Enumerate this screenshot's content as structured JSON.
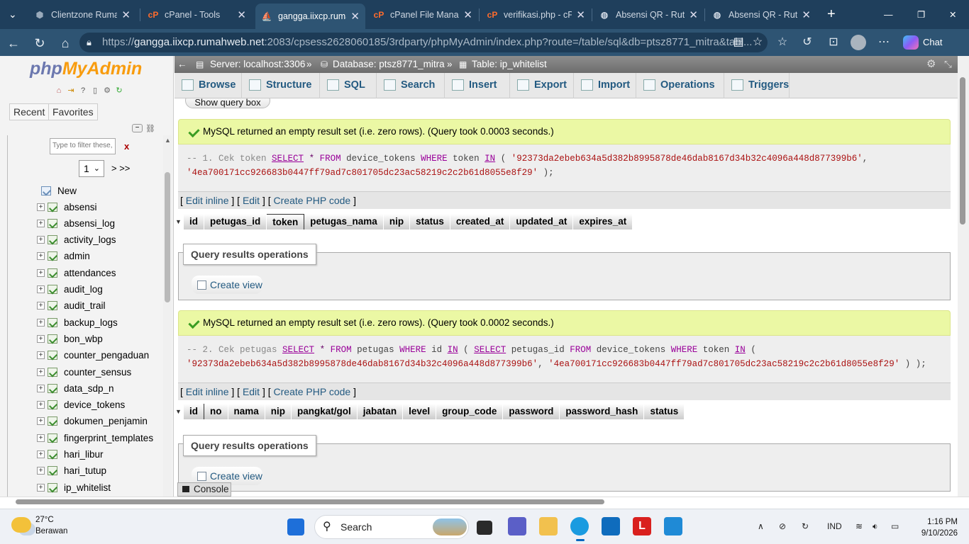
{
  "browser": {
    "tabs": [
      {
        "label": "Clientzone Rumahweb",
        "icon": "clientzone-icon"
      },
      {
        "label": "cPanel - Tools",
        "icon": "cpanel-icon"
      },
      {
        "label": "gangga.iixcp.rumahweb.net",
        "icon": "phpmyadmin-icon",
        "active": true
      },
      {
        "label": "cPanel File Manager",
        "icon": "cpanel-icon"
      },
      {
        "label": "verifikasi.php - cPanel",
        "icon": "cpanel-icon"
      },
      {
        "label": "Absensi QR - Rutan",
        "icon": "globe-icon"
      },
      {
        "label": "Absensi QR - Rutan",
        "icon": "globe-icon"
      }
    ],
    "url_prefix": "https://",
    "url_host": "gangga.iixcp.rumahweb.net",
    "url_rest": ":2083/cpsess2628060185/3rdparty/phpMyAdmin/index.php?route=/table/sql&db=ptsz8771_mitra&tabl...",
    "chat_label": "Chat"
  },
  "sidebar": {
    "logo_php": "php",
    "logo_myadmin": "MyAdmin",
    "recent_label": "Recent",
    "favorites_label": "Favorites",
    "filter_placeholder": "Type to filter these, E",
    "filter_clear": "x",
    "page_value": "1",
    "page_next": "> >>",
    "new_label": "New",
    "tables": [
      "absensi",
      "absensi_log",
      "activity_logs",
      "admin",
      "attendances",
      "audit_log",
      "audit_trail",
      "backup_logs",
      "bon_wbp",
      "counter_pengaduan",
      "counter_sensus",
      "data_sdp_n",
      "device_tokens",
      "dokumen_penjamin",
      "fingerprint_templates",
      "hari_libur",
      "hari_tutup",
      "ip_whitelist"
    ]
  },
  "breadcrumb": {
    "server": "Server: localhost:3306",
    "database": "Database: ptsz8771_mitra",
    "table": "Table: ip_whitelist",
    "sep": "»"
  },
  "menu": [
    {
      "label": "Browse",
      "icon": "browse-icon"
    },
    {
      "label": "Structure",
      "icon": "structure-icon"
    },
    {
      "label": "SQL",
      "icon": "sql-icon"
    },
    {
      "label": "Search",
      "icon": "search-icon"
    },
    {
      "label": "Insert",
      "icon": "insert-icon"
    },
    {
      "label": "Export",
      "icon": "export-icon"
    },
    {
      "label": "Import",
      "icon": "import-icon"
    },
    {
      "label": "Operations",
      "icon": "operations-icon"
    },
    {
      "label": "Triggers",
      "icon": "triggers-icon"
    }
  ],
  "content": {
    "show_query_box": "Show query box",
    "results": [
      {
        "message": "MySQL returned an empty result set (i.e. zero rows). (Query took 0.0003 seconds.)",
        "sql_line1": "-- 1. Cek token SELECT * FROM device_tokens WHERE token IN ( '92373da2ebeb634a5d382b8995878de46dab8167d34b32c4096a448d877399b6',",
        "sql_line2": "'4ea700171cc926683b0447ff79ad7c801705dc23ac58219c2c2b61d8055e8f29' );",
        "columns": [
          "id",
          "petugas_id",
          "token",
          "petugas_nama",
          "nip",
          "status",
          "created_at",
          "updated_at",
          "expires_at"
        ]
      },
      {
        "message": "MySQL returned an empty result set (i.e. zero rows). (Query took 0.0002 seconds.)",
        "sql_line1": "-- 2. Cek petugas SELECT * FROM petugas WHERE id IN ( SELECT petugas_id FROM device_tokens WHERE token IN (",
        "sql_line2": "'92373da2ebeb634a5d382b8995878de46dab8167d34b32c4096a448d877399b6', '4ea700171cc926683b0447ff79ad7c801705dc23ac58219c2c2b61d8055e8f29' ) );",
        "columns": [
          "id",
          "no",
          "nama",
          "nip",
          "pangkat/gol",
          "jabatan",
          "level",
          "group_code",
          "password",
          "password_hash",
          "status"
        ]
      }
    ],
    "edit_inline": "Edit inline",
    "edit": "Edit",
    "create_php": "Create PHP code",
    "qro_label": "Query results operations",
    "create_view": "Create view",
    "console_label": "Console"
  },
  "taskbar": {
    "temperature": "27°C",
    "weather": "Berawan",
    "search_label": "Search",
    "lang": "IND",
    "time": "1:16 PM",
    "date": "9/10/2026"
  },
  "colors": {
    "accent": "#235a81",
    "success_bg": "#ebf8a4",
    "browser_chrome": "#2e5473"
  }
}
